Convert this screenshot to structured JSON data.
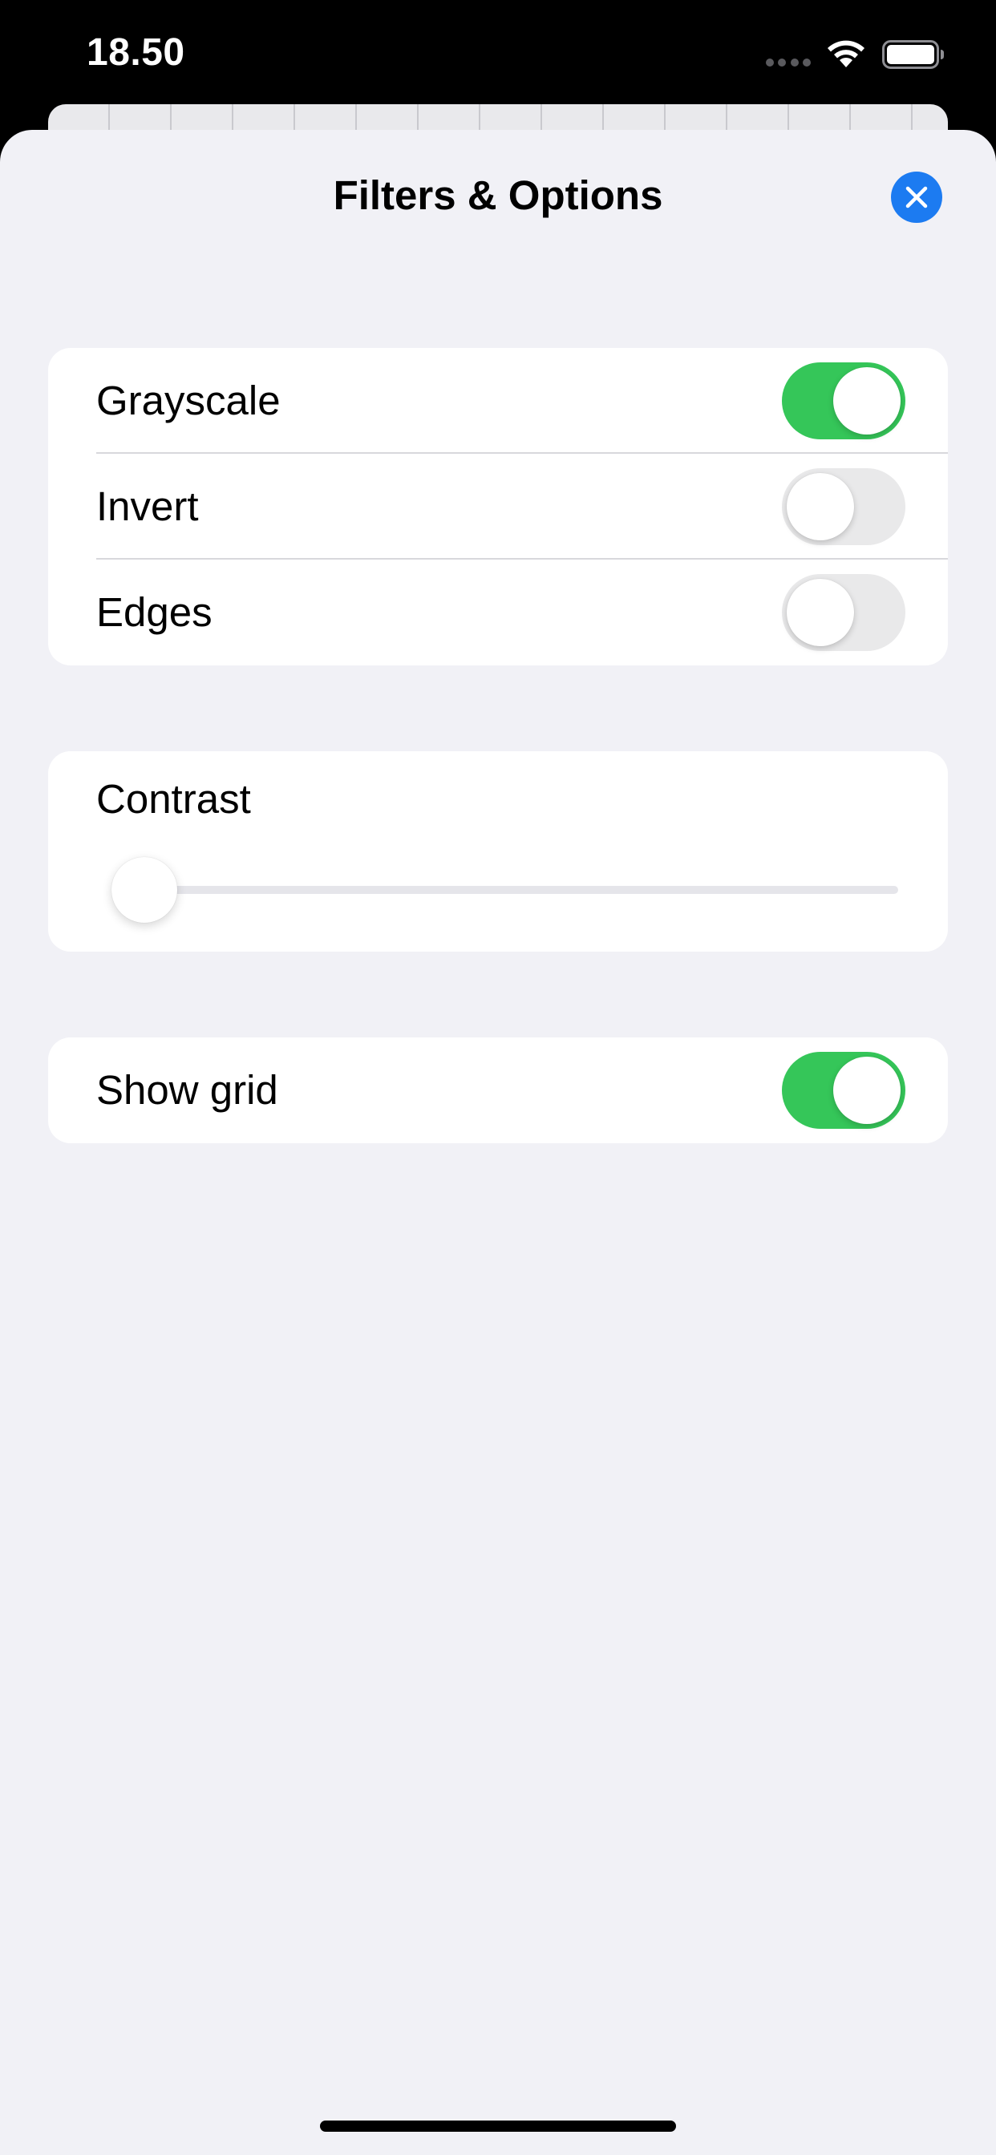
{
  "status_bar": {
    "time": "18.50",
    "icons": [
      "signal-dots-icon",
      "wifi-icon",
      "battery-icon"
    ]
  },
  "sheet": {
    "title": "Filters & Options",
    "close_icon": "close-icon"
  },
  "filters": [
    {
      "label": "Grayscale",
      "enabled": true
    },
    {
      "label": "Invert",
      "enabled": false
    },
    {
      "label": "Edges",
      "enabled": false
    }
  ],
  "contrast": {
    "label": "Contrast",
    "value": 0.0
  },
  "display": {
    "show_grid_label": "Show grid",
    "show_grid_enabled": true
  },
  "colors": {
    "accent": "#1c7bf1",
    "toggle_on": "#35c659",
    "toggle_off": "#e9e9ea",
    "sheet_background": "#f1f1f6"
  }
}
